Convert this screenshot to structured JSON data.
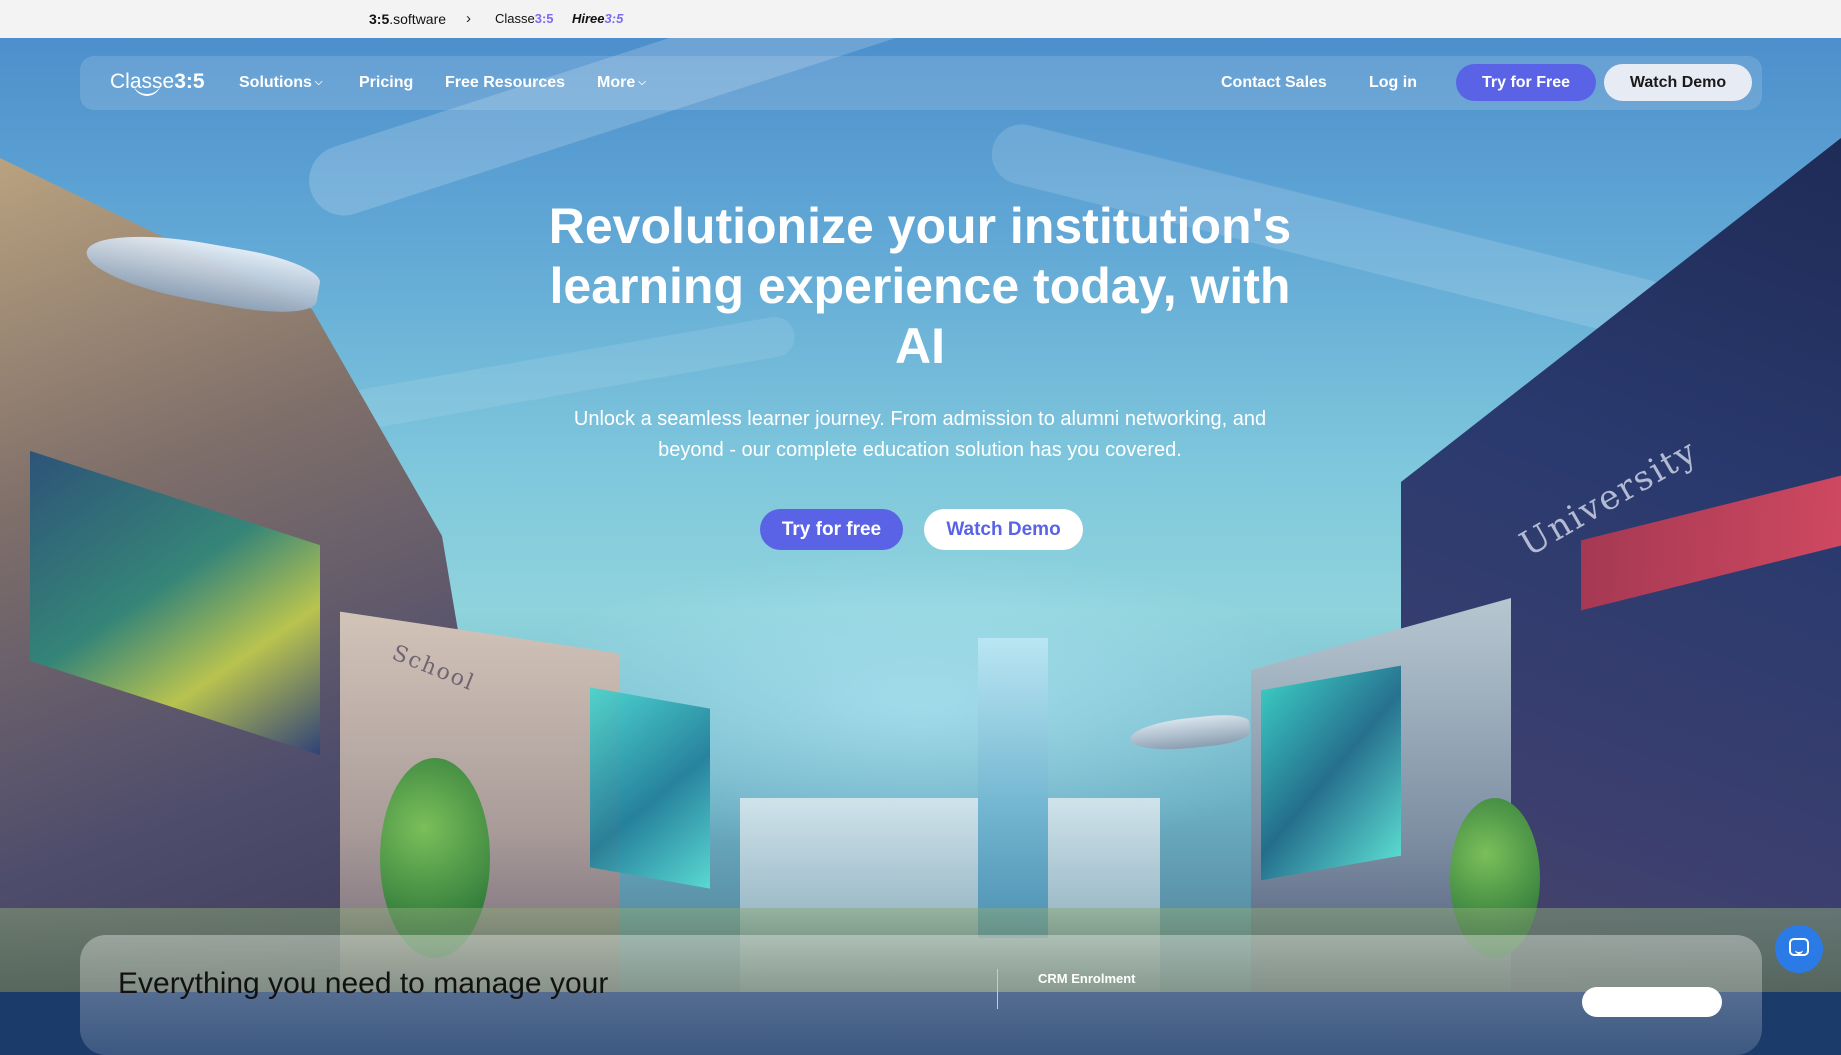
{
  "topbar": {
    "brands": [
      {
        "name_bold": "3:5",
        "name_rest": ".software"
      },
      {
        "name": "Classe",
        "suffix": "3:5"
      },
      {
        "name": "Hiree",
        "suffix": "3:5"
      }
    ],
    "separator": "›"
  },
  "nav": {
    "logo_text": "Classe",
    "logo_suffix": "3:5",
    "links": [
      "Solutions",
      "Pricing",
      "Free Resources",
      "More"
    ],
    "contact_sales": "Contact Sales",
    "login": "Log in",
    "try_free": "Try for Free",
    "watch_demo": "Watch Demo"
  },
  "hero": {
    "title": "Revolutionize your institution's learning experience today, with AI",
    "subtitle": "Unlock a seamless learner journey. From admission to alumni networking, and beyond - our complete education solution has you covered.",
    "cta_primary": "Try for free",
    "cta_secondary": "Watch Demo",
    "illustration_signs": [
      "School",
      "University"
    ]
  },
  "card": {
    "heading": "Everything you need to manage your",
    "tab_label": "CRM Enrolment"
  },
  "colors": {
    "accent": "#5a63e6",
    "chat": "#2b7be6"
  },
  "icons": {
    "caret": "chevron-down-icon",
    "chat": "chat-bubble-icon"
  }
}
